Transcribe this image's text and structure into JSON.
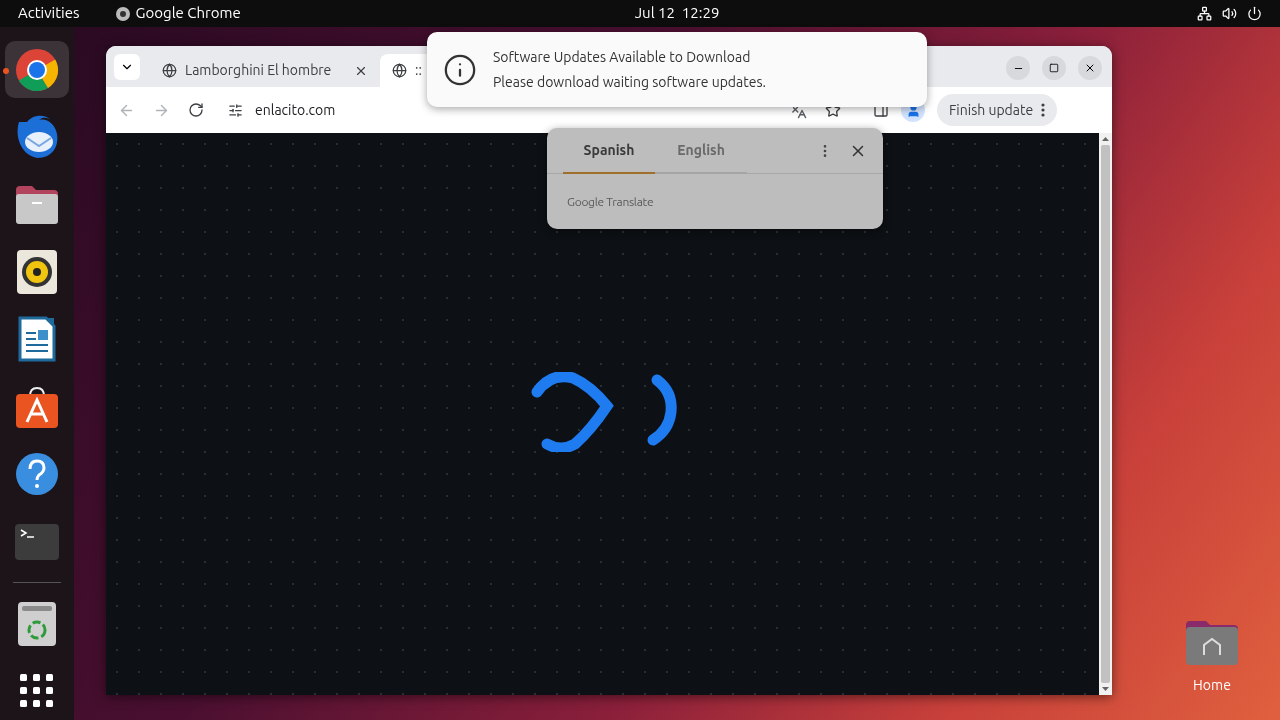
{
  "top_bar": {
    "activities": "Activities",
    "app_name": "Google Chrome",
    "clock": "Jul 12  12:29"
  },
  "dock": {
    "items": [
      {
        "kind": "chrome",
        "selected": true
      },
      {
        "kind": "mail",
        "selected": false
      },
      {
        "kind": "files",
        "selected": false
      },
      {
        "kind": "music",
        "selected": false
      },
      {
        "kind": "writer",
        "selected": false
      },
      {
        "kind": "store",
        "selected": false
      },
      {
        "kind": "help",
        "selected": false
      },
      {
        "kind": "terminal",
        "selected": false
      },
      {
        "kind": "trash",
        "selected": false
      },
      {
        "kind": "apps",
        "selected": false
      }
    ]
  },
  "browser": {
    "tabs": [
      {
        "title": "Lamborghini El hombre",
        "selected": false
      },
      {
        "title": "::",
        "selected": true
      }
    ],
    "address": "enlacito.com",
    "finish_update": "Finish update"
  },
  "translate_popup": {
    "languages": [
      {
        "label": "Spanish",
        "selected": true
      },
      {
        "label": "English",
        "selected": false
      }
    ],
    "footer": "Google Translate"
  },
  "notification": {
    "title": "Software Updates Available to Download",
    "body": "Please download waiting software updates."
  },
  "desktop_icons": [
    {
      "label": "Home"
    }
  ]
}
